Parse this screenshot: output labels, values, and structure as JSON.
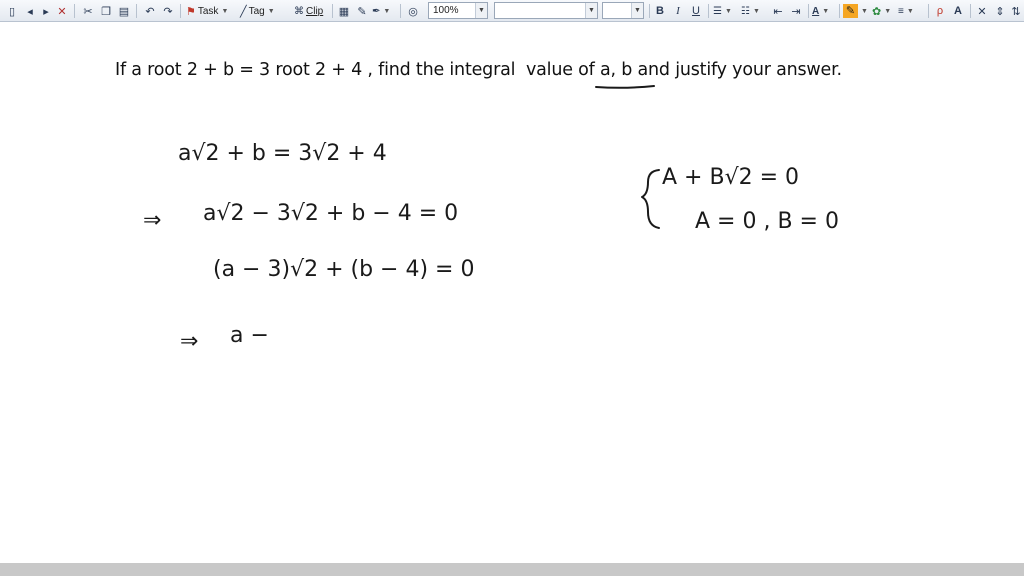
{
  "toolbar": {
    "task_label": "Task",
    "tag_label": "Tag",
    "clip_label": "Clip",
    "zoom_value": "100%",
    "bold_label": "B",
    "italic_label": "I",
    "underline_label": "U",
    "font_color_glyph": "A",
    "superscript_label": "A",
    "accent_color": "#f5a623",
    "highlight_color": "#f5a623"
  },
  "question": {
    "text_before_underline": "If a root 2 + b = 3 root 2 + 4 , find the integral  value ",
    "underlined_text": "of a, b",
    "text_after_underline": " and justify your answer."
  },
  "handwriting": {
    "line1": "a√2 + b = 3√2 + 4",
    "line2_arrow": "⇒",
    "line2": "a√2 − 3√2 + b − 4 = 0",
    "line3": "(a − 3)√2 + (b − 4) = 0",
    "line4_arrow": "⇒",
    "line4": "a −",
    "side_line1": "A + B√2 = 0",
    "side_line2": "A = 0 , B = 0"
  }
}
